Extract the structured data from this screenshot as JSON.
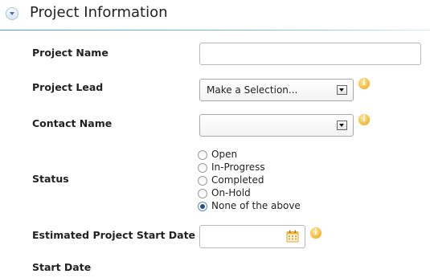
{
  "header": {
    "title": "Project Information",
    "collapse_icon": "chevron-down-icon"
  },
  "fields": {
    "project_name": {
      "label": "Project Name",
      "value": ""
    },
    "project_lead": {
      "label": "Project Lead",
      "selected": "Make a Selection...",
      "help_icon": "info-icon"
    },
    "contact_name": {
      "label": "Contact Name",
      "selected": "",
      "help_icon": "info-icon"
    },
    "status": {
      "label": "Status",
      "options": [
        "Open",
        "In-Progress",
        "Completed",
        "On-Hold",
        "None of the above"
      ],
      "selected": "None of the above"
    },
    "estimated_start_date": {
      "label": "Estimated Project Start Date",
      "value": "",
      "picker_icon": "calendar-icon",
      "help_icon": "info-icon"
    },
    "start_date": {
      "label": "Start Date"
    }
  },
  "colors": {
    "accent": "#4aa6c9",
    "help_icon": "#f2b631",
    "radio_selected": "#1e4f8e"
  }
}
